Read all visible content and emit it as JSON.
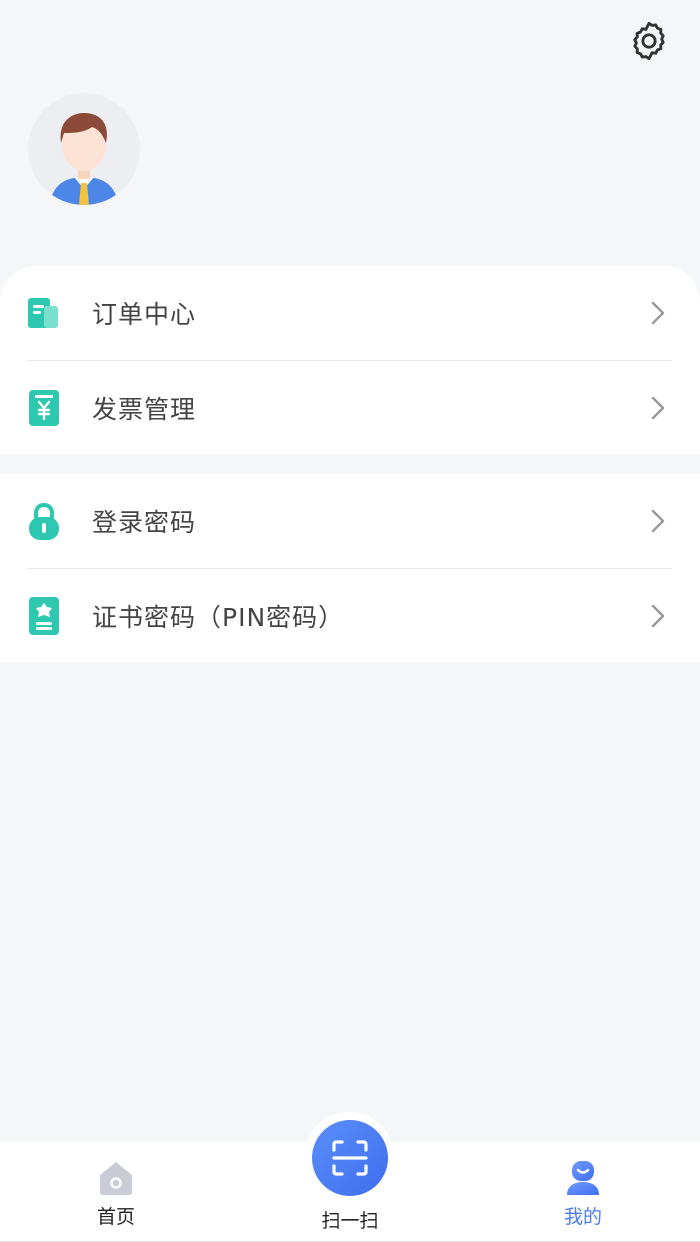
{
  "header": {
    "settings_icon": "gear-icon"
  },
  "profile": {
    "avatar_icon": "user-avatar-icon"
  },
  "menu_group_1": [
    {
      "label": "订单中心",
      "icon": "order-icon"
    },
    {
      "label": "发票管理",
      "icon": "invoice-icon"
    }
  ],
  "menu_group_2": [
    {
      "label": "登录密码",
      "icon": "lock-icon"
    },
    {
      "label": "证书密码（PIN密码）",
      "icon": "certificate-icon"
    }
  ],
  "tabbar": {
    "home_label": "首页",
    "scan_label": "扫一扫",
    "mine_label": "我的"
  },
  "colors": {
    "accent": "#4f7cf6",
    "icon_teal": "#2ec7b0",
    "background": "#f5f6f8"
  }
}
